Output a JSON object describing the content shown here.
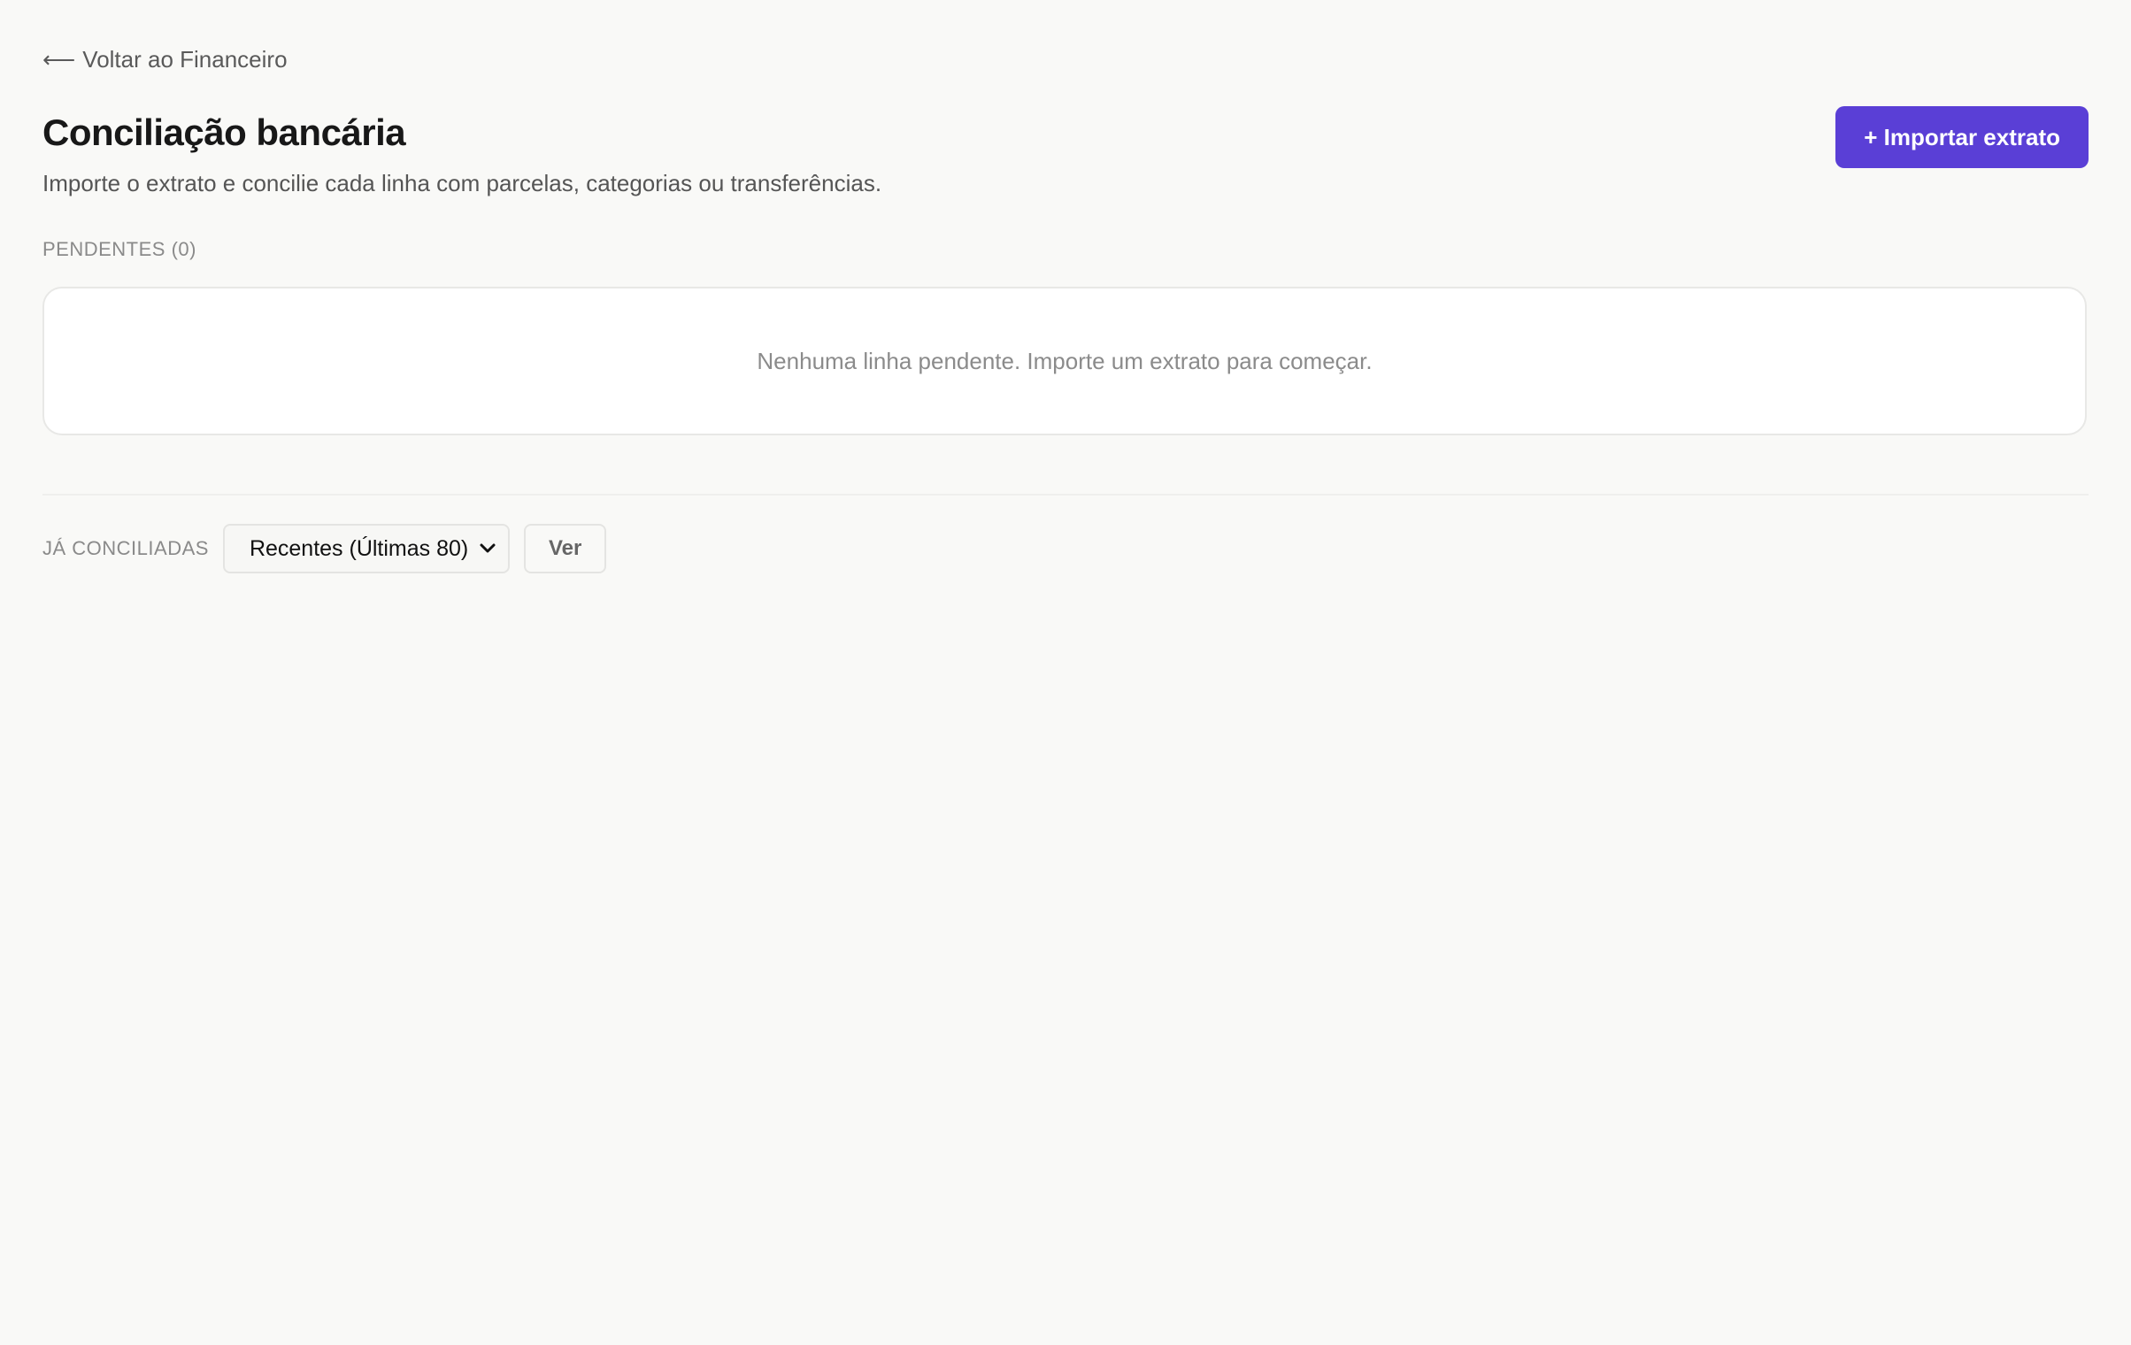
{
  "nav": {
    "back_arrow": "⟵",
    "back_label": "Voltar ao Financeiro"
  },
  "header": {
    "title": "Conciliação bancária",
    "subtitle": "Importe o extrato e concilie cada linha com parcelas, categorias ou transferências.",
    "import_button_label": "+ Importar extrato"
  },
  "pending": {
    "label": "PENDENTES (0)",
    "empty_message": "Nenhuma linha pendente. Importe um extrato para começar."
  },
  "reconciled": {
    "label": "JÁ CONCILIADAS",
    "filter_selected": "Recentes (Últimas 80)",
    "view_button_label": "Ver"
  },
  "colors": {
    "background": "#f9f9f7",
    "accent": "#5a3fd6",
    "card_background": "#ffffff"
  },
  "icons": {
    "back": "arrow-left-icon",
    "select": "chevron-down-icon"
  }
}
